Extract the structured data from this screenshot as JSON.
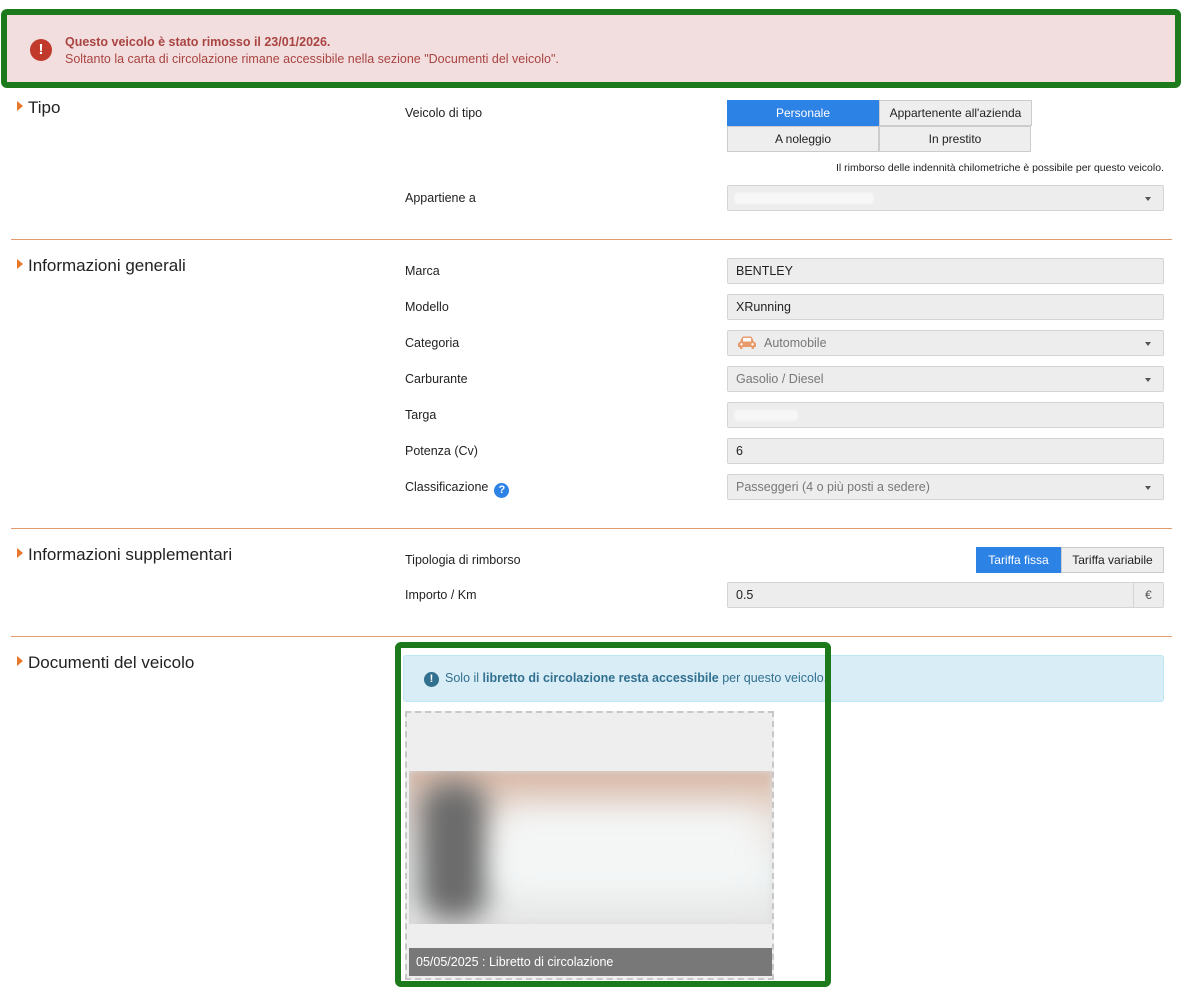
{
  "alert": {
    "title": "Questo veicolo è stato rimosso il 23/01/2026.",
    "message": "Soltanto la carta di circolazione rimane accessibile nella sezione \"Documenti del veicolo\".",
    "color": "#a94442"
  },
  "sections": {
    "tipo": "Tipo",
    "generali": "Informazioni generali",
    "supplementari": "Informazioni supplementari",
    "documenti": "Documenti del veicolo"
  },
  "tipo": {
    "vehicle_type_label": "Veicolo di tipo",
    "options": [
      "Personale",
      "Appartenente all'azienda",
      "A noleggio",
      "In prestito"
    ],
    "selected": "Personale",
    "note": "Il rimborso delle indennità chilometriche è possibile per questo veicolo.",
    "owner_label": "Appartiene a",
    "owner_value": ""
  },
  "generali": {
    "marca_label": "Marca",
    "marca_value": "BENTLEY",
    "modello_label": "Modello",
    "modello_value": "XRunning",
    "categoria_label": "Categoria",
    "categoria_value": "Automobile",
    "categoria_icon": "car-icon",
    "carburante_label": "Carburante",
    "carburante_value": "Gasolio / Diesel",
    "targa_label": "Targa",
    "targa_value": "",
    "potenza_label": "Potenza (Cv)",
    "potenza_value": "6",
    "classificazione_label": "Classificazione",
    "classificazione_help": "?",
    "classificazione_value": "Passeggeri (4 o più posti a sedere)"
  },
  "supplementari": {
    "rimborso_label": "Tipologia di rimborso",
    "rimborso_options": [
      "Tariffa fissa",
      "Tariffa variabile"
    ],
    "rimborso_selected": "Tariffa fissa",
    "importo_label": "Importo / Km",
    "importo_value": "0.5",
    "currency": "€"
  },
  "documenti": {
    "info_prefix": "Solo il ",
    "info_bold": "libretto di circolazione resta accessibile",
    "info_suffix": " per questo veicolo.",
    "doc_caption": "05/05/2025 : Libretto di circolazione"
  },
  "colors": {
    "accent_blue": "#2d82e6",
    "highlight_green": "#1c7a1c",
    "section_orange": "#e8762b"
  }
}
